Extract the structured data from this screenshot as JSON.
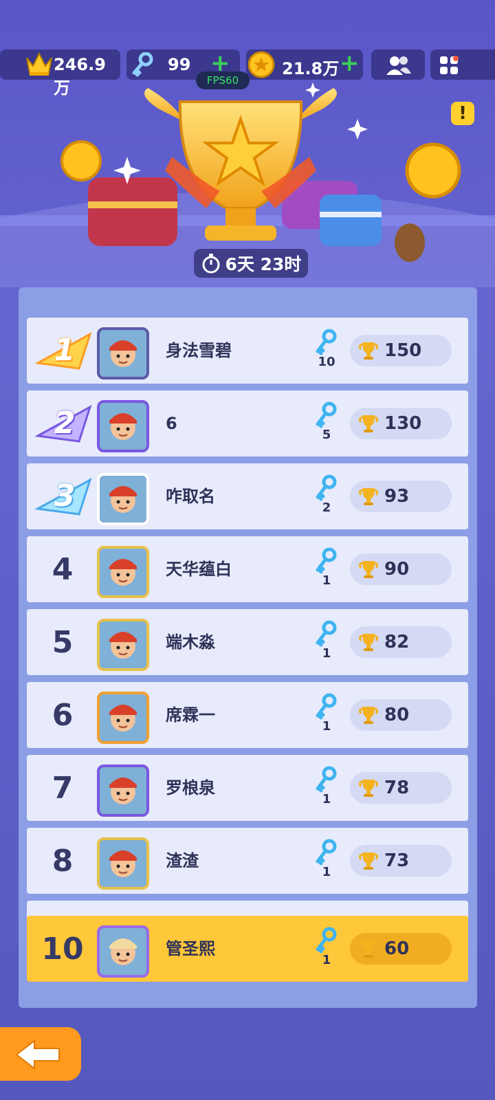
{
  "header": {
    "crowns": "246.9万",
    "keys": "99",
    "coins": "21.8万",
    "fps": "FPS60",
    "plus": "+",
    "friends_icon": "friends-icon",
    "menu_icon": "grid-menu-icon"
  },
  "event": {
    "timer": "6天 23时",
    "warning": "!"
  },
  "leaderboard": {
    "rows": [
      {
        "rank": "1",
        "name": "身法雪碧",
        "keys": "10",
        "score": "150",
        "medal": "gold"
      },
      {
        "rank": "2",
        "name": "6",
        "keys": "5",
        "score": "130",
        "medal": "silver"
      },
      {
        "rank": "3",
        "name": "咋取名",
        "keys": "2",
        "score": "93",
        "medal": "bronze"
      },
      {
        "rank": "4",
        "name": "天华蕴白",
        "keys": "1",
        "score": "90"
      },
      {
        "rank": "5",
        "name": "端木淼",
        "keys": "1",
        "score": "82"
      },
      {
        "rank": "6",
        "name": "席霖一",
        "keys": "1",
        "score": "80"
      },
      {
        "rank": "7",
        "name": "罗桹泉",
        "keys": "1",
        "score": "78"
      },
      {
        "rank": "8",
        "name": "渣渣",
        "keys": "1",
        "score": "73"
      }
    ],
    "me": {
      "rank": "10",
      "name": "管圣熙",
      "keys": "1",
      "score": "60"
    }
  },
  "colors": {
    "accent": "#ffc73a",
    "background": "#5a56c8",
    "plus": "#39d15a"
  }
}
